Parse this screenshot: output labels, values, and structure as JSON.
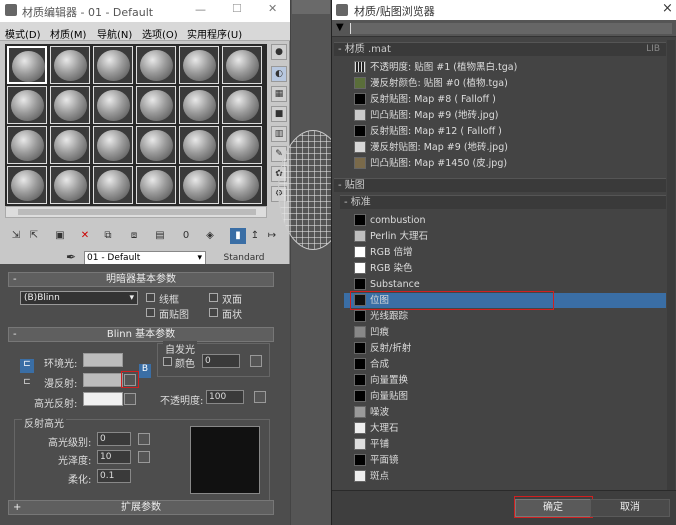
{
  "editor": {
    "title": "材质编辑器 - 01 - Default",
    "menu": [
      "模式(D)",
      "材质(M)",
      "导航(N)",
      "选项(O)",
      "实用程序(U)"
    ],
    "material_name": "01 - Default",
    "material_type": "Standard",
    "shader_rollout": "明暗器基本参数",
    "shader": "(B)Blinn",
    "shader_opts": [
      "线框",
      "双面",
      "面贴图",
      "面状"
    ],
    "blinn_rollout": "Blinn 基本参数",
    "self_illum": "自发光",
    "color_label": "颜色",
    "color_value": "0",
    "ambient": "环境光:",
    "diffuse": "漫反射:",
    "specular": "高光反射:",
    "opacity_label": "不透明度:",
    "opacity_value": "100",
    "spec_hl": "反射高光",
    "spec_level": "高光级别:",
    "spec_level_v": "0",
    "gloss": "光泽度:",
    "gloss_v": "10",
    "soften": "柔化:",
    "soften_v": "0.1",
    "ext_rollout": "扩展参数",
    "minus": "-",
    "plus": "+"
  },
  "browser": {
    "title": "材质/贴图浏览器",
    "group1": "- 材质 .mat",
    "lib": "LIB",
    "group1_items": [
      "不透明度: 贴图 #1 (植物黑白.tga)",
      "漫反射颜色: 贴图 #0 (植物.tga)",
      "反射贴图: Map #8 ( Falloff )",
      "凹凸贴图: Map #9 (地砖.jpg)",
      "反射贴图: Map #12 ( Falloff )",
      "漫反射贴图: Map #9 (地砖.jpg)",
      "凹凸贴图: Map #1450 (皮.jpg)"
    ],
    "group2": "- 贴图",
    "group3": "- 标准",
    "maps": [
      "combustion",
      "Perlin 大理石",
      "RGB 倍增",
      "RGB 染色",
      "Substance",
      "位图",
      "光线跟踪",
      "凹痕",
      "反射/折射",
      "合成",
      "向量置换",
      "向量贴图",
      "噪波",
      "大理石",
      "平铺",
      "平面镜",
      "斑点"
    ],
    "selected": "位图",
    "ok": "确定",
    "cancel": "取消",
    "close": "×"
  },
  "colors": {
    "accent": "#3a6ea5",
    "highlight": "#d02020"
  }
}
